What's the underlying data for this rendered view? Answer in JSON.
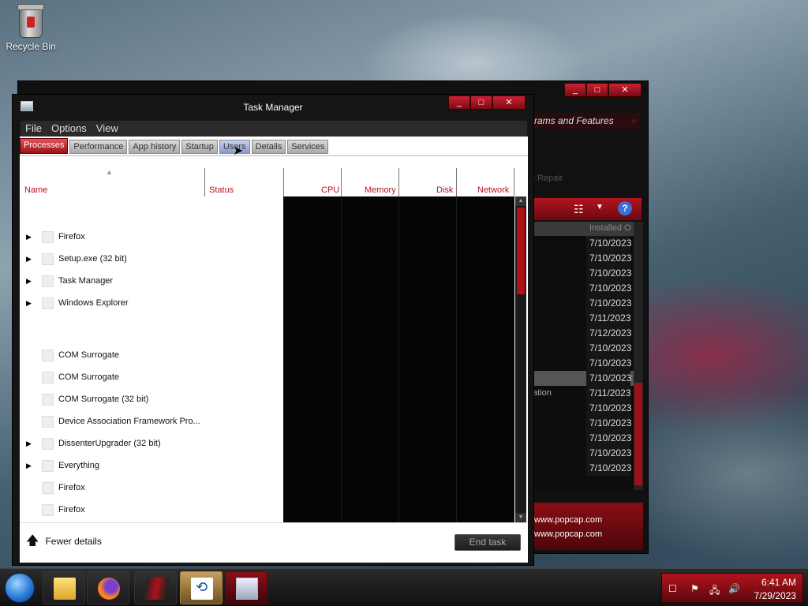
{
  "desktop": {
    "recycle_bin_label": "Recycle Bin"
  },
  "background_window": {
    "search_text": "rams and Features",
    "faint_text": "ll Repair",
    "column_header": "Installed O",
    "dates": [
      "7/10/2023",
      "7/10/2023",
      "7/10/2023",
      "7/10/2023",
      "7/10/2023",
      "7/11/2023",
      "7/12/2023",
      "7/10/2023",
      "7/10/2023",
      "7/10/2023",
      "7/11/2023",
      "7/10/2023",
      "7/10/2023",
      "7/10/2023",
      "7/10/2023",
      "7/10/2023"
    ],
    "mid_text": "ation",
    "publisher_lines": [
      "www.popcap.com",
      "www.popcap.com"
    ]
  },
  "task_manager": {
    "title": "Task Manager",
    "menu": [
      "File",
      "Options",
      "View"
    ],
    "tabs": [
      "Processes",
      "Performance",
      "App history",
      "Startup",
      "Users",
      "Details",
      "Services"
    ],
    "active_tab": "Processes",
    "columns": {
      "name": "Name",
      "status": "Status",
      "cpu": "CPU",
      "memory": "Memory",
      "disk": "Disk",
      "network": "Network"
    },
    "processes": [
      {
        "name": "Firefox",
        "expandable": true
      },
      {
        "name": "Setup.exe (32 bit)",
        "expandable": true
      },
      {
        "name": "Task Manager",
        "expandable": true
      },
      {
        "name": "Windows Explorer",
        "expandable": true
      },
      {
        "name": "COM Surrogate",
        "expandable": false
      },
      {
        "name": "COM Surrogate",
        "expandable": false
      },
      {
        "name": "COM Surrogate (32 bit)",
        "expandable": false
      },
      {
        "name": "Device Association Framework Pro...",
        "expandable": false
      },
      {
        "name": "DissenterUpgrader (32 bit)",
        "expandable": true
      },
      {
        "name": "Everything",
        "expandable": true
      },
      {
        "name": "Firefox",
        "expandable": false
      },
      {
        "name": "Firefox",
        "expandable": false
      }
    ],
    "fewer_details": "Fewer details",
    "end_task": "End task"
  },
  "taskbar": {
    "apps": [
      "file-explorer-icon",
      "firefox-icon",
      "game-icon",
      "installer-icon",
      "task-manager-icon"
    ],
    "clock_time": "6:41 AM",
    "clock_date": "7/29/2023"
  },
  "colors": {
    "accent_red": "#b01018",
    "header_text": "#b8141c"
  }
}
